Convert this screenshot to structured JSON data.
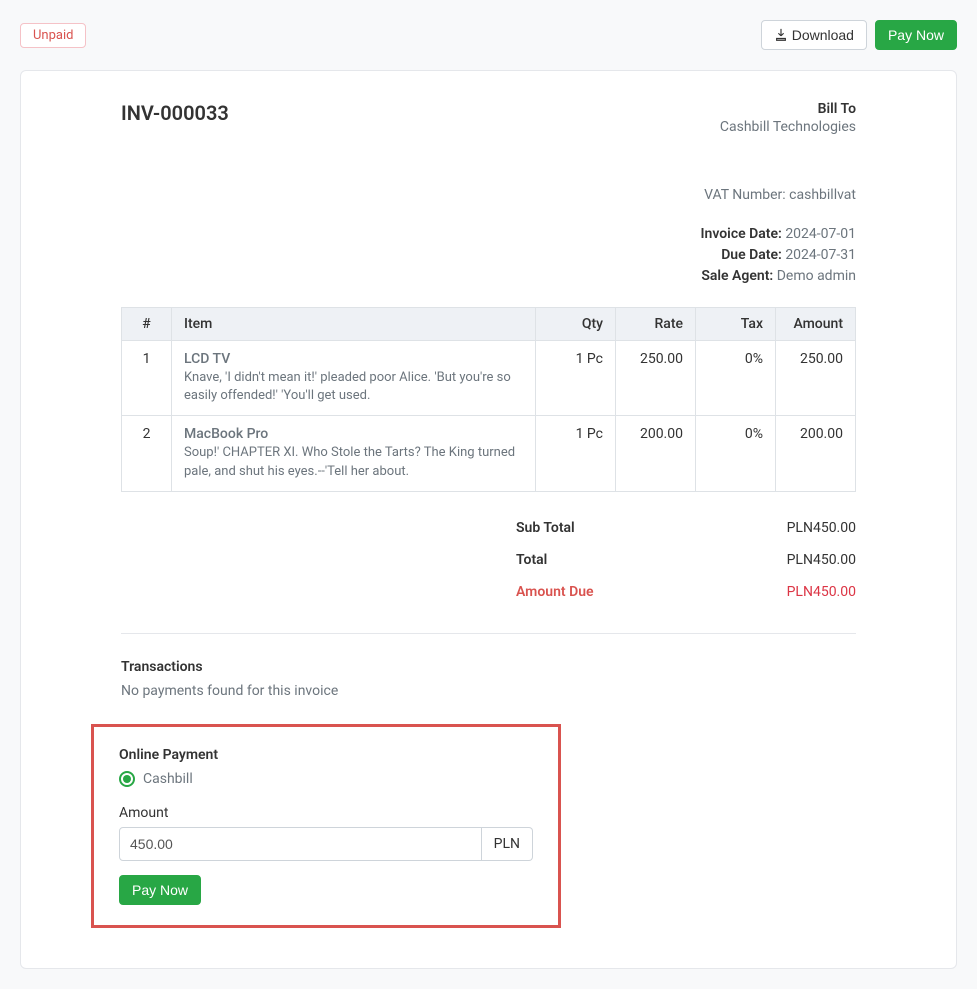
{
  "status_badge": "Unpaid",
  "buttons": {
    "download": "Download",
    "pay_now": "Pay Now"
  },
  "invoice": {
    "number": "INV-000033",
    "bill_to_label": "Bill To",
    "bill_to_name": "Cashbill Technologies",
    "vat_label": "VAT Number: cashbillvat",
    "invoice_date_label": "Invoice Date:",
    "invoice_date": "2024-07-01",
    "due_date_label": "Due Date:",
    "due_date": "2024-07-31",
    "sale_agent_label": "Sale Agent:",
    "sale_agent": "Demo admin"
  },
  "table": {
    "headers": {
      "num": "#",
      "item": "Item",
      "qty": "Qty",
      "rate": "Rate",
      "tax": "Tax",
      "amount": "Amount"
    },
    "rows": [
      {
        "num": "1",
        "name": "LCD TV",
        "desc": "Knave, 'I didn't mean it!' pleaded poor Alice. 'But you're so easily offended!' 'You'll get used.",
        "qty": "1 Pc",
        "rate": "250.00",
        "tax": "0%",
        "amount": "250.00"
      },
      {
        "num": "2",
        "name": "MacBook Pro",
        "desc": "Soup!' CHAPTER XI. Who Stole the Tarts? The King turned pale, and shut his eyes.--'Tell her about.",
        "qty": "1 Pc",
        "rate": "200.00",
        "tax": "0%",
        "amount": "200.00"
      }
    ]
  },
  "totals": {
    "subtotal_label": "Sub Total",
    "subtotal": "PLN450.00",
    "total_label": "Total",
    "total": "PLN450.00",
    "due_label": "Amount Due",
    "due": "PLN450.00"
  },
  "transactions": {
    "title": "Transactions",
    "empty_text": "No payments found for this invoice"
  },
  "payment": {
    "title": "Online Payment",
    "option_cashbill": "Cashbill",
    "amount_label": "Amount",
    "amount_value": "450.00",
    "currency": "PLN",
    "pay_now": "Pay Now"
  }
}
